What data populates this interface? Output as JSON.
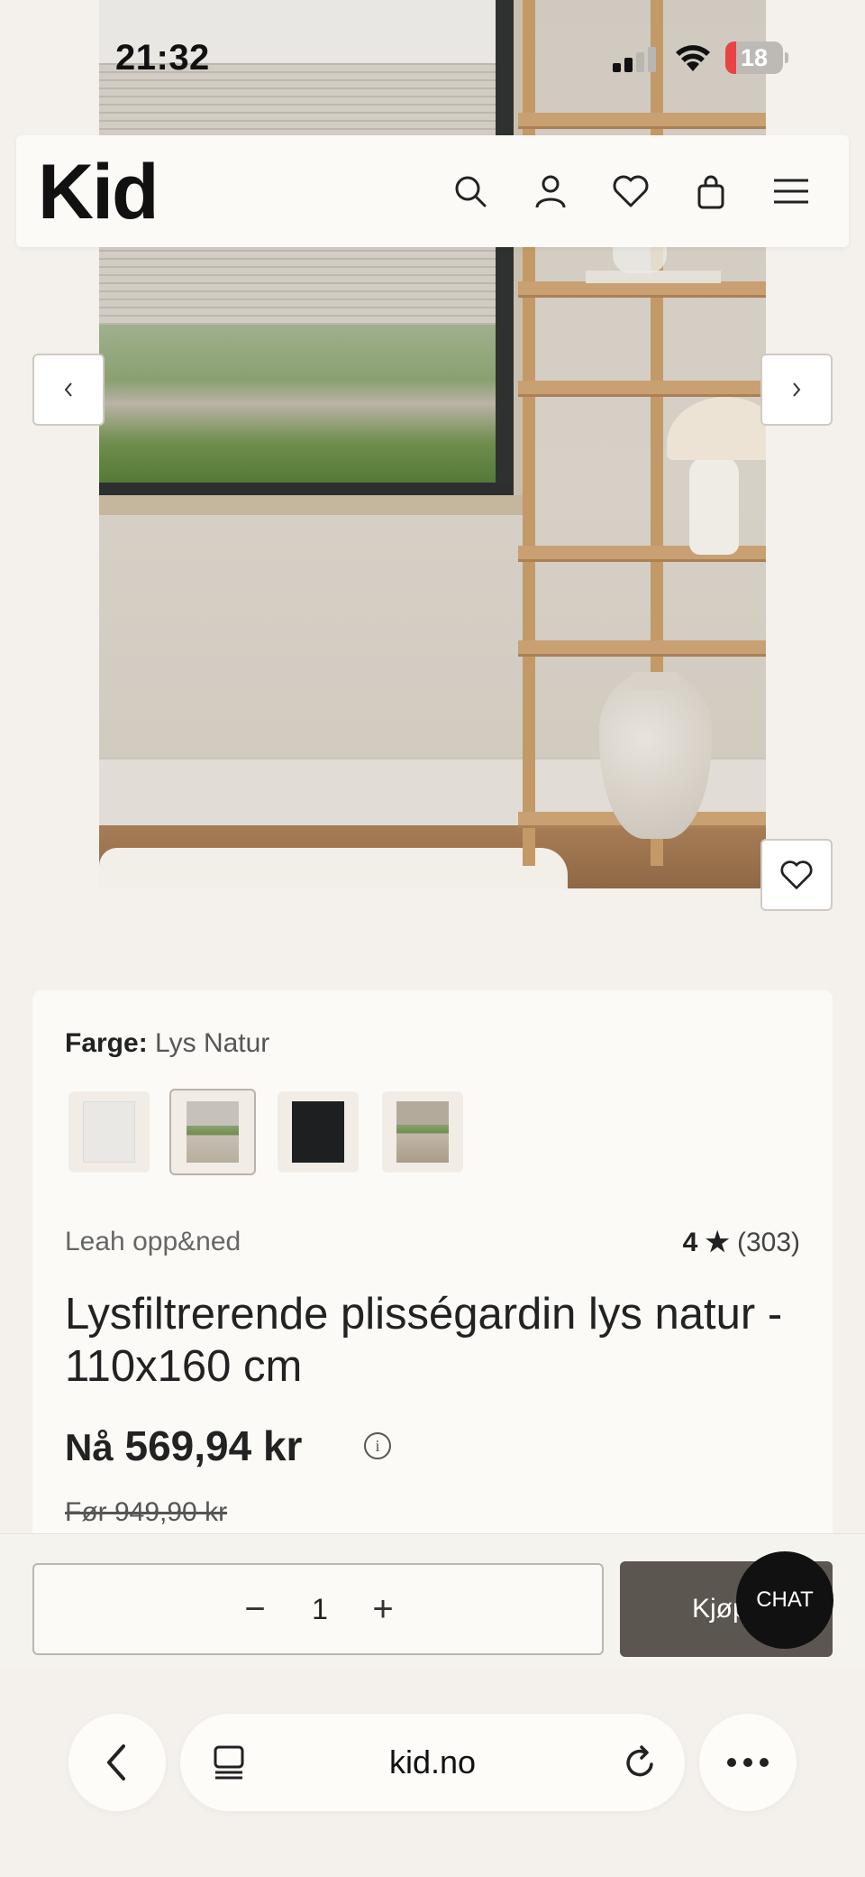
{
  "status_bar": {
    "time": "21:32",
    "battery": "18",
    "battery_level": 0.18,
    "signal_bars": 2,
    "icons": [
      "signal-icon",
      "wifi-icon",
      "battery-icon"
    ]
  },
  "header": {
    "logo": "Kid",
    "icons": [
      "search-icon",
      "account-icon",
      "heart-icon",
      "bag-icon",
      "menu-icon"
    ]
  },
  "gallery": {
    "prev_icon": "chevron-left-icon",
    "next_icon": "chevron-right-icon",
    "favorite_icon": "heart-icon"
  },
  "product": {
    "color_label": "Farge:",
    "color_value": "Lys Natur",
    "swatches": [
      {
        "name": "white",
        "color": "#e9e8e5"
      },
      {
        "name": "lys-natur",
        "color": "#b8ae9e",
        "selected": true
      },
      {
        "name": "black",
        "color": "#1e1f21"
      },
      {
        "name": "natur",
        "color": "#a99c88"
      }
    ],
    "brand": "Leah opp&ned",
    "rating_value": "4",
    "rating_star": "★",
    "rating_count": "(303)",
    "title": "Lysfiltrerende plisségardin lys natur - 110x160 cm",
    "price_prefix": "Nå",
    "price": "569,94 kr",
    "info_glyph": "i",
    "old_price": "Før 949,90 kr"
  },
  "buy_bar": {
    "minus": "−",
    "quantity": "1",
    "plus": "+",
    "buy_label": "Kjøp",
    "chat_label": "CHAT"
  },
  "browser": {
    "url": "kid.no",
    "icons": [
      "back-icon",
      "tabs-icon",
      "reload-icon",
      "more-icon"
    ]
  },
  "colors": {
    "background": "#f4f1ec",
    "card": "#fbfaf6",
    "buy_button": "#5c5650",
    "chat_button": "#111111"
  }
}
